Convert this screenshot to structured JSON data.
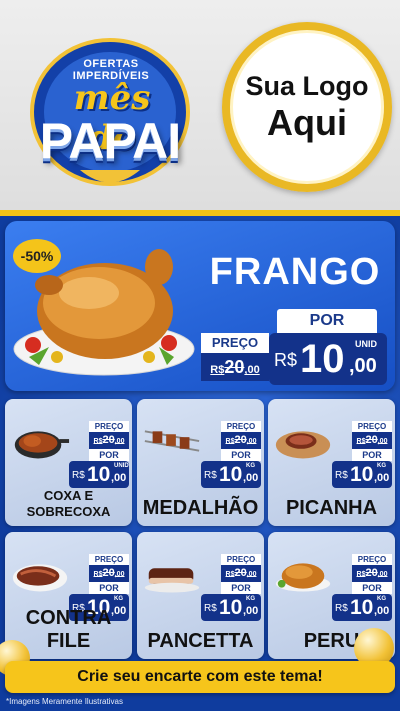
{
  "header": {
    "badge_arc": "OFERTAS IMPERDÍVEIS",
    "badge_script": "mês do",
    "badge_main": "PAPAI",
    "logo_line1": "Sua Logo",
    "logo_line2": "Aqui"
  },
  "featured": {
    "name": "FRANGO",
    "discount": "-50%",
    "preco_label": "PREÇO",
    "old_currency": "R$",
    "old_int": "20",
    "old_dec": ",00",
    "por_label": "POR",
    "currency": "R$",
    "price_int": "10",
    "price_dec": ",00",
    "unit": "UNID"
  },
  "products": [
    {
      "name_l1": "COXA E",
      "name_l2": "SOBRECOXA",
      "preco_label": "PREÇO",
      "old_currency": "R$",
      "old_int": "20",
      "old_dec": ",00",
      "por_label": "POR",
      "currency": "R$",
      "price_int": "10",
      "price_dec": ",00",
      "unit": "UNID",
      "icon": "chicken-legs-pan-icon"
    },
    {
      "name_l1": "MEDALHÃO",
      "name_l2": "",
      "preco_label": "PREÇO",
      "old_currency": "R$",
      "old_int": "20",
      "old_dec": ",00",
      "por_label": "POR",
      "currency": "R$",
      "price_int": "10",
      "price_dec": ",00",
      "unit": "KG",
      "icon": "skewers-icon"
    },
    {
      "name_l1": "PICANHA",
      "name_l2": "",
      "preco_label": "PREÇO",
      "old_currency": "R$",
      "old_int": "20",
      "old_dec": ",00",
      "por_label": "POR",
      "currency": "R$",
      "price_int": "10",
      "price_dec": ",00",
      "unit": "KG",
      "icon": "steak-board-icon"
    },
    {
      "name_l1": "CONTRA FILE",
      "name_l2": "",
      "preco_label": "PREÇO",
      "old_currency": "R$",
      "old_int": "20",
      "old_dec": ",00",
      "por_label": "POR",
      "currency": "R$",
      "price_int": "10",
      "price_dec": ",00",
      "unit": "KG",
      "icon": "steak-icon"
    },
    {
      "name_l1": "PANCETTA",
      "name_l2": "",
      "preco_label": "PREÇO",
      "old_currency": "R$",
      "old_int": "20",
      "old_dec": ",00",
      "por_label": "POR",
      "currency": "R$",
      "price_int": "10",
      "price_dec": ",00",
      "unit": "KG",
      "icon": "pork-belly-icon"
    },
    {
      "name_l1": "PERU",
      "name_l2": "",
      "preco_label": "PREÇO",
      "old_currency": "R$",
      "old_int": "20",
      "old_dec": ",00",
      "por_label": "POR",
      "currency": "R$",
      "price_int": "10",
      "price_dec": ",00",
      "unit": "KG",
      "icon": "roast-turkey-icon"
    }
  ],
  "cta": "Crie seu encarte com este tema!",
  "disclaimer": "*Imagens Meramente Ilustrativas",
  "colors": {
    "brand_blue": "#164fc4",
    "price_navy": "#13328a",
    "accent_yellow": "#f6c51b"
  }
}
